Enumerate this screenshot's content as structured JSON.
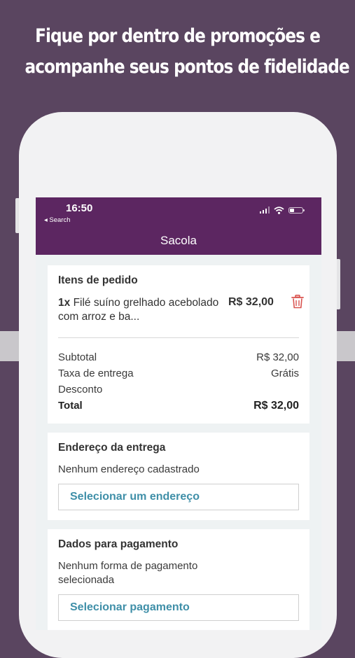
{
  "promo": {
    "line1": "Fique por dentro de promoções e",
    "line2": "acompanhe seus pontos de fidelidade"
  },
  "status_bar": {
    "time": "16:50",
    "back_label": "◂ Search"
  },
  "header": {
    "title": "Sacola",
    "color": "#5c2661"
  },
  "order": {
    "section_title": "Itens de pedido",
    "items": [
      {
        "quantity": "1x",
        "name": "Filé suíno grelhado acebolado com arroz e ba...",
        "price": "R$ 32,00",
        "icon": "trash-icon"
      }
    ],
    "summary": {
      "subtotal_label": "Subtotal",
      "subtotal_value": "R$ 32,00",
      "delivery_label": "Taxa de entrega",
      "delivery_value": "Grátis",
      "discount_label": "Desconto",
      "total_label": "Total",
      "total_value": "R$ 32,00"
    }
  },
  "address": {
    "section_title": "Endereço da entrega",
    "empty_text": "Nenhum endereço cadastrado",
    "button_label": "Selecionar um endereço"
  },
  "payment": {
    "section_title": "Dados para pagamento",
    "empty_text_line1": "Nenhum forma de pagamento",
    "empty_text_line2": "selecionada",
    "button_label": "Selecionar pagamento"
  },
  "colors": {
    "background": "#5a4560",
    "accent": "#3f8fa8",
    "delete": "#d9534f"
  }
}
